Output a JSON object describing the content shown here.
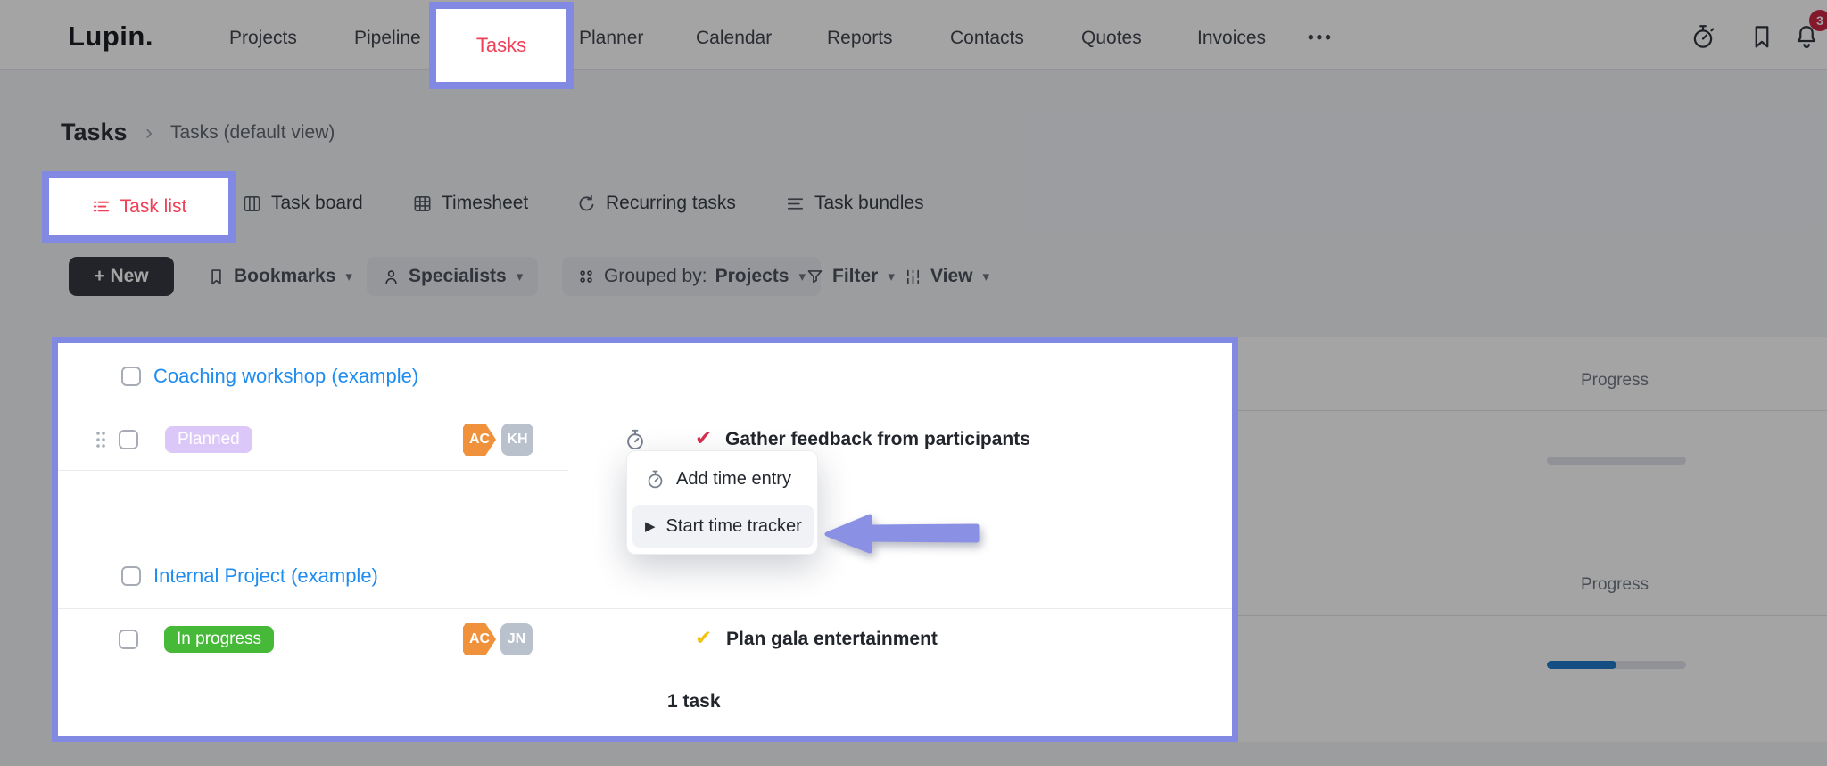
{
  "nav": {
    "logo": "Lupin.",
    "items": [
      "Projects",
      "Pipeline",
      "Tasks",
      "Planner",
      "Calendar",
      "Reports",
      "Contacts",
      "Quotes",
      "Invoices"
    ],
    "more": "•••",
    "notification_count": "3",
    "right_icons": [
      "timer-icon",
      "bookmark-icon",
      "bell-icon"
    ]
  },
  "breadcrumb": {
    "section": "Tasks",
    "separator": "›",
    "current": "Tasks (default view)"
  },
  "tabs": {
    "active": "Task list",
    "items": [
      "Task list",
      "Task board",
      "Timesheet",
      "Recurring tasks",
      "Task bundles"
    ]
  },
  "toolbar": {
    "new_label": "+ New",
    "bookmarks_label": "Bookmarks",
    "specialists_label": "Specialists",
    "grouped_prefix": "Grouped by:",
    "grouped_value": "Projects",
    "filter_label": "Filter",
    "view_label": "View",
    "caret": "▾"
  },
  "menu": {
    "items": [
      {
        "icon": "stopwatch-icon",
        "label": "Add time entry"
      },
      {
        "icon": "play-icon",
        "label": "Start time tracker"
      }
    ]
  },
  "table": {
    "progress_header": "Progress",
    "groups": [
      {
        "name": "Coaching workshop (example)",
        "task": {
          "status": "Planned",
          "status_color": "#dcc8f8",
          "assignees": [
            "AC",
            "KH"
          ],
          "check": "✔",
          "check_color": "#d63051",
          "title": "Gather feedback from participants"
        },
        "progress_percent": 0
      },
      {
        "name": "Internal Project (example)",
        "task": {
          "status": "In progress",
          "status_color": "#47b939",
          "assignees": [
            "AC",
            "JN"
          ],
          "check": "✔",
          "check_color": "#f4c20d",
          "title": "Plan gala entertainment"
        },
        "progress_percent": 50
      }
    ],
    "footer": "1 task"
  },
  "glyphs": {
    "play": "▶"
  },
  "colors": {
    "annotation_purple": "#8289e2",
    "accent_red": "#ee4056",
    "link_blue": "#1e8cf0",
    "avatar_orange": "#f0923b",
    "avatar_gray": "#b9c1cd",
    "progress_blue": "#1b76c8",
    "notification_red": "#c9203f",
    "button_dark": "#30333a"
  }
}
